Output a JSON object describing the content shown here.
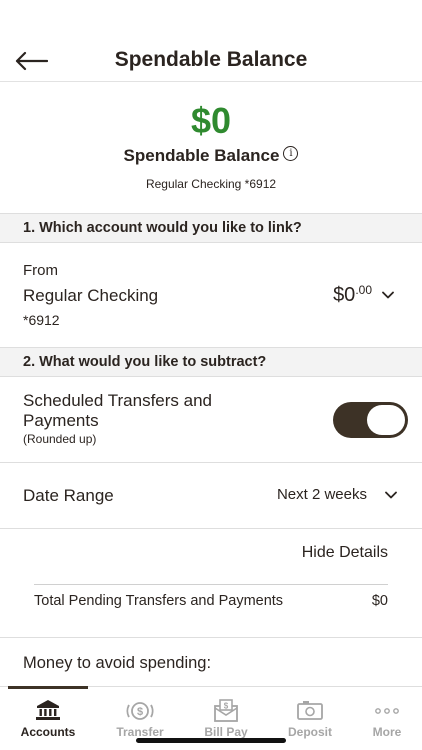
{
  "header": {
    "title": "Spendable Balance"
  },
  "balance": {
    "amount": "$0",
    "label": "Spendable Balance",
    "info_glyph": "i",
    "account": "Regular Checking *6912"
  },
  "section1": {
    "title": "1. Which account would you like to link?"
  },
  "from": {
    "label": "From",
    "account_name": "Regular Checking",
    "account_mask": "*6912",
    "amount_whole": "$0",
    "amount_cents": ".00"
  },
  "section2": {
    "title": "2. What would you like to subtract?"
  },
  "scheduled": {
    "label": "Scheduled Transfers and Payments",
    "sublabel": "(Rounded up)",
    "enabled": true
  },
  "date_range": {
    "label": "Date Range",
    "value": "Next 2 weeks"
  },
  "details": {
    "hide_label": "Hide Details",
    "pending_label": "Total Pending Transfers and Payments",
    "pending_value": "$0"
  },
  "avoid": {
    "label": "Money to avoid spending:"
  },
  "tabs": [
    {
      "label": "Accounts",
      "icon": "bank-icon",
      "active": true
    },
    {
      "label": "Transfer",
      "icon": "transfer-icon",
      "active": false
    },
    {
      "label": "Bill Pay",
      "icon": "bill-pay-icon",
      "active": false
    },
    {
      "label": "Deposit",
      "icon": "deposit-icon",
      "active": false
    },
    {
      "label": "More",
      "icon": "more-icon",
      "active": false
    }
  ],
  "colors": {
    "accent_green": "#2f8a2f",
    "brand_brown": "#3d3226",
    "inactive_gray": "#a6a6a6"
  }
}
